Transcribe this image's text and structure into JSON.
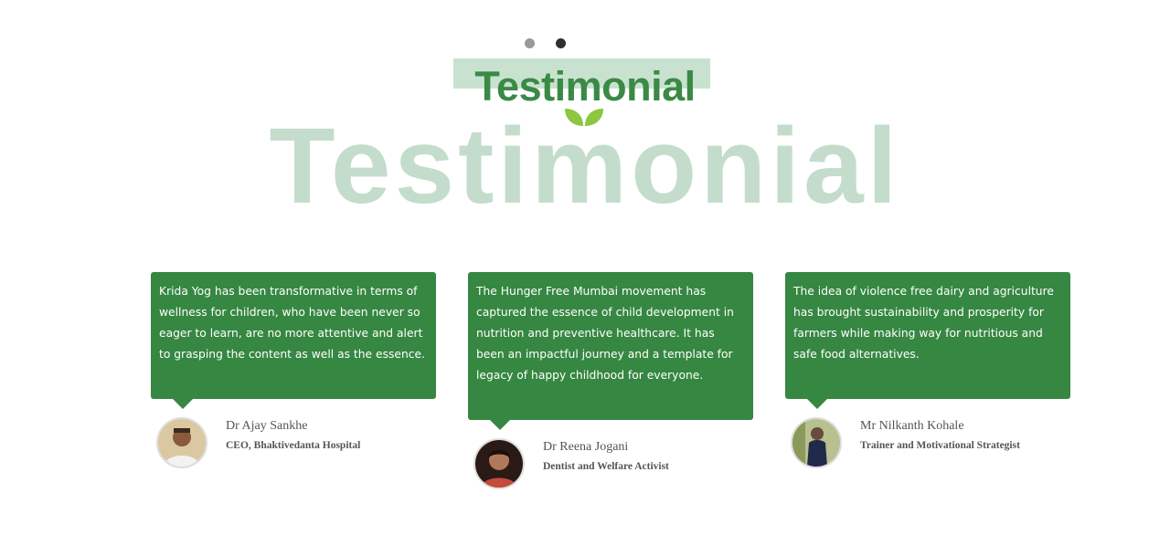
{
  "carousel": {
    "dots": 2,
    "active_index": 1
  },
  "section": {
    "title": "Testimonial",
    "bg_title": "Testimonial"
  },
  "colors": {
    "accent": "#368741",
    "title": "#3a8a45",
    "watermark": "#c4dccc",
    "leaf": "#8dc63f"
  },
  "testimonials": [
    {
      "quote": "Krida Yog has been transformative in terms of wellness for children, who have been never so eager to learn, are no more attentive and alert to grasping the content as well as the essence.",
      "name": "Dr Ajay Sankhe",
      "role": "CEO, Bhaktivedanta Hospital"
    },
    {
      "quote": "The Hunger Free Mumbai movement has captured the essence of child development in nutrition and preventive healthcare. It has been an impactful journey and a template for legacy of happy childhood for everyone.",
      "name": "Dr Reena Jogani",
      "role": "Dentist and Welfare Activist"
    },
    {
      "quote": "The idea of violence free dairy and agriculture has brought sustainability and prosperity for farmers while making way for nutritious and safe food alternatives.",
      "name": "Mr Nilkanth Kohale",
      "role": "Trainer and Motivational Strategist"
    }
  ]
}
